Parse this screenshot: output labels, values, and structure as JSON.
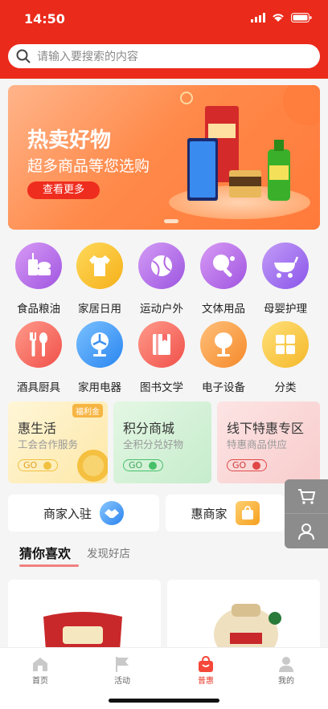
{
  "status": {
    "time": "14:50"
  },
  "search": {
    "placeholder": "请输入要搜索的内容"
  },
  "banner": {
    "title": "热卖好物",
    "subtitle": "超多商品等您选购",
    "button": "查看更多"
  },
  "categories": [
    {
      "label": "食品粮油",
      "icon": "food-icon",
      "color": "#b76de8"
    },
    {
      "label": "家居日用",
      "icon": "tshirt-icon",
      "color": "#f8c232"
    },
    {
      "label": "运动户外",
      "icon": "ball-icon",
      "color": "#b56ae4"
    },
    {
      "label": "文体用品",
      "icon": "pingpong-icon",
      "color": "#b76de8"
    },
    {
      "label": "母婴护理",
      "icon": "stroller-icon",
      "color": "#a66ef0"
    },
    {
      "label": "酒具厨具",
      "icon": "cutlery-icon",
      "color": "#f76a6a"
    },
    {
      "label": "家用电器",
      "icon": "fan-icon",
      "color": "#4aa2f5"
    },
    {
      "label": "图书文学",
      "icon": "book-icon",
      "color": "#f76a6a"
    },
    {
      "label": "电子设备",
      "icon": "mirror-icon",
      "color": "#f99a3c"
    },
    {
      "label": "分类",
      "icon": "grid-icon",
      "color": "#f8c232"
    }
  ],
  "promos": [
    {
      "title": "惠生活",
      "subtitle": "工会合作服务",
      "go": "GO",
      "tag": "福利金",
      "color": "#f0c040"
    },
    {
      "title": "积分商城",
      "subtitle": "全积分兑好物",
      "go": "GO",
      "color": "#46c06a"
    },
    {
      "title": "线下特惠专区",
      "subtitle": "特惠商品供应",
      "go": "GO",
      "color": "#e04848"
    }
  ],
  "merchants": [
    {
      "label": "商家入驻",
      "icon": "handshake-icon"
    },
    {
      "label": "惠商家",
      "icon": "shop-bag-icon"
    }
  ],
  "feed_tabs": {
    "active": "猜你喜欢",
    "inactive": "发现好店"
  },
  "bottom_nav": [
    {
      "label": "首页",
      "icon": "home-icon"
    },
    {
      "label": "活动",
      "icon": "flag-icon"
    },
    {
      "label": "普惠",
      "icon": "bag-icon",
      "active": true
    },
    {
      "label": "我的",
      "icon": "user-icon"
    }
  ]
}
